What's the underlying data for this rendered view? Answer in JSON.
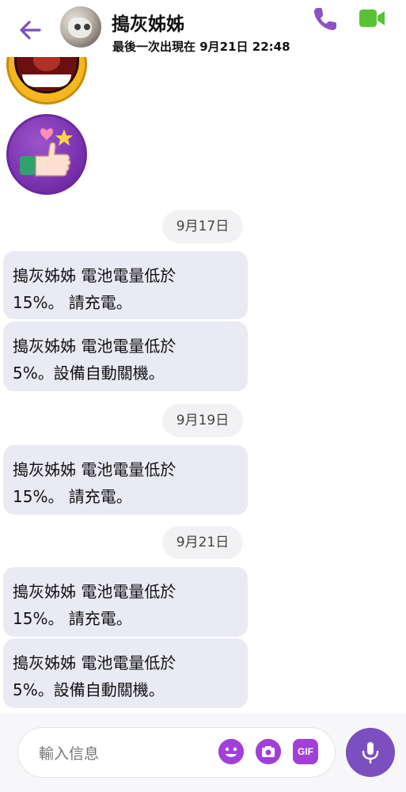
{
  "header": {
    "contact_name": "搗灰姊姊",
    "last_seen": "最後一次出現在 9月21日 22:48"
  },
  "icons": {
    "back": "back-arrow-icon",
    "call": "phone-icon",
    "video": "video-camera-icon",
    "emoji": "emoji-icon",
    "camera": "camera-icon",
    "gif": "gif-icon",
    "mic": "microphone-icon"
  },
  "colors": {
    "accent": "#7b4fc1",
    "video_green": "#59c234",
    "bubble": "#e9eaf4"
  },
  "messages": {
    "d1": "9月17日",
    "m1": "搗灰姊姊 電池電量低於\n15%。 請充電。",
    "m2": "搗灰姊姊 電池電量低於\n5%。設備自動關機。",
    "d2": "9月19日",
    "m3": "搗灰姊姊 電池電量低於\n15%。 請充電。",
    "d3": "9月21日",
    "m4": "搗灰姊姊 電池電量低於\n15%。 請充電。",
    "m5": "搗灰姊姊 電池電量低於\n5%。設備自動關機。"
  },
  "composer": {
    "placeholder": "輸入信息",
    "gif_label": "GIF"
  }
}
